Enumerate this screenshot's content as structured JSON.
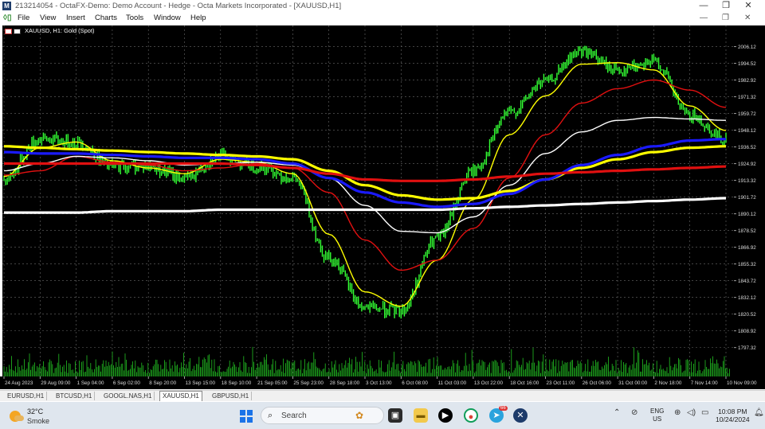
{
  "titlebar": {
    "app_icon": "metatrader-icon",
    "title": "213214054 - OctaFX-Demo: Demo Account - Hedge - Octa Markets Incorporated - [XAUUSD,H1]",
    "minimize": "—",
    "restore": "❐",
    "close": "✕"
  },
  "menubar": {
    "items": [
      "File",
      "View",
      "Insert",
      "Charts",
      "Tools",
      "Window",
      "Help"
    ],
    "child_controls": [
      "—",
      "❐",
      "✕"
    ]
  },
  "chart": {
    "symbol_label": "XAUUSD, H1:  Gold (Spot)",
    "colors": {
      "background": "#000000",
      "candles": "#33ff33",
      "ma_yellow": "#ffff00",
      "ma_blue": "#1a1aff",
      "ma_red": "#e01010",
      "ma_white": "#ffffff",
      "grid": "#6a6a6a",
      "volume": "#22c022"
    },
    "price_labels": [
      "2006.12",
      "1994.52",
      "1982.92",
      "1971.32",
      "1959.72",
      "1948.12",
      "1936.52",
      "1924.92",
      "1913.32",
      "1901.72",
      "1890.12",
      "1878.52",
      "1866.92",
      "1855.32",
      "1843.72",
      "1832.12",
      "1820.52",
      "1808.92",
      "1797.32"
    ],
    "time_labels": [
      "24 Aug 2023",
      "29 Aug 09:00",
      "1 Sep 04:00",
      "6 Sep 02:00",
      "8 Sep 20:00",
      "13 Sep 15:00",
      "18 Sep 10:00",
      "21 Sep 05:00",
      "25 Sep 23:00",
      "28 Sep 18:00",
      "3 Oct 13:00",
      "6 Oct 08:00",
      "11 Oct 03:00",
      "13 Oct 22:00",
      "18 Oct 16:00",
      "23 Oct 11:00",
      "26 Oct 06:00",
      "31 Oct 00:00",
      "2 Nov 18:00",
      "7 Nov 14:00",
      "10 Nov 09:00"
    ]
  },
  "chart_data": {
    "type": "line",
    "title": "XAUUSD, H1: Gold (Spot)",
    "xlabel": "",
    "ylabel": "",
    "ylim": [
      1790,
      2012
    ],
    "grid": true,
    "x": [
      "24 Aug 2023",
      "29 Aug 09:00",
      "1 Sep 04:00",
      "6 Sep 02:00",
      "8 Sep 20:00",
      "13 Sep 15:00",
      "18 Sep 10:00",
      "21 Sep 05:00",
      "25 Sep 23:00",
      "28 Sep 18:00",
      "3 Oct 13:00",
      "6 Oct 08:00",
      "11 Oct 03:00",
      "13 Oct 22:00",
      "18 Oct 16:00",
      "23 Oct 11:00",
      "26 Oct 06:00",
      "31 Oct 00:00",
      "2 Nov 18:00",
      "7 Nov 14:00",
      "10 Nov 09:00"
    ],
    "series": [
      {
        "role": "price",
        "color": "#33ff33",
        "values": [
          1914,
          1942,
          1940,
          1923,
          1923,
          1915,
          1930,
          1923,
          1915,
          1860,
          1825,
          1823,
          1873,
          1920,
          1960,
          1982,
          2003,
          1990,
          1996,
          1958,
          1942
        ]
      },
      {
        "role": "ma-fast",
        "color": "#ffff00",
        "values": [
          1916,
          1936,
          1940,
          1927,
          1922,
          1918,
          1928,
          1926,
          1918,
          1876,
          1836,
          1826,
          1858,
          1900,
          1945,
          1972,
          1994,
          1995,
          1990,
          1965,
          1948
        ]
      },
      {
        "role": "ma-mid",
        "color": "#e01010",
        "values": [
          1917,
          1920,
          1930,
          1926,
          1924,
          1920,
          1922,
          1925,
          1922,
          1905,
          1872,
          1851,
          1858,
          1880,
          1915,
          1945,
          1967,
          1977,
          1983,
          1976,
          1964
        ]
      },
      {
        "role": "ma-slow",
        "color": "#ffffff",
        "values": [
          1920,
          1925,
          1930,
          1929,
          1927,
          1924,
          1925,
          1926,
          1924,
          1915,
          1896,
          1878,
          1877,
          1888,
          1910,
          1932,
          1947,
          1955,
          1957,
          1956,
          1955
        ]
      },
      {
        "role": "ma-long-yellow",
        "color": "#ffff00",
        "values": [
          1937,
          1936,
          1935,
          1934,
          1933,
          1932,
          1931,
          1930,
          1928,
          1920,
          1910,
          1903,
          1900,
          1901,
          1906,
          1914,
          1922,
          1928,
          1933,
          1936,
          1937
        ]
      },
      {
        "role": "ma-long-blue",
        "color": "#1a1aff",
        "values": [
          1933,
          1932,
          1932,
          1931,
          1930,
          1929,
          1929,
          1928,
          1925,
          1915,
          1905,
          1898,
          1895,
          1897,
          1904,
          1914,
          1924,
          1931,
          1937,
          1941,
          1942
        ]
      },
      {
        "role": "ma-long-red",
        "color": "#e01010",
        "values": [
          1925,
          1925,
          1925,
          1925,
          1925,
          1925,
          1925,
          1924,
          1922,
          1918,
          1914,
          1913,
          1913,
          1914,
          1916,
          1918,
          1919,
          1920,
          1921,
          1922,
          1923
        ]
      },
      {
        "role": "ma-long-white",
        "color": "#ffffff",
        "values": [
          1891,
          1891,
          1891,
          1892,
          1892,
          1892,
          1893,
          1893,
          1893,
          1893,
          1893,
          1893,
          1893,
          1894,
          1895,
          1896,
          1897,
          1898,
          1899,
          1900,
          1901
        ]
      }
    ]
  },
  "tabs": [
    "EURUSD,H1",
    "BTCUSD,H1",
    "GOOGL.NAS,H1",
    "XAUUSD,H1",
    "GBPUSD,H1"
  ],
  "active_tab": "XAUUSD,H1",
  "taskbar": {
    "weather_temp": "32°C",
    "weather_desc": "Smoke",
    "search_placeholder": "Search",
    "lang_top": "ENG",
    "lang_bottom": "US",
    "time": "10:08 PM",
    "date": "10/24/2024",
    "badge": "66"
  }
}
